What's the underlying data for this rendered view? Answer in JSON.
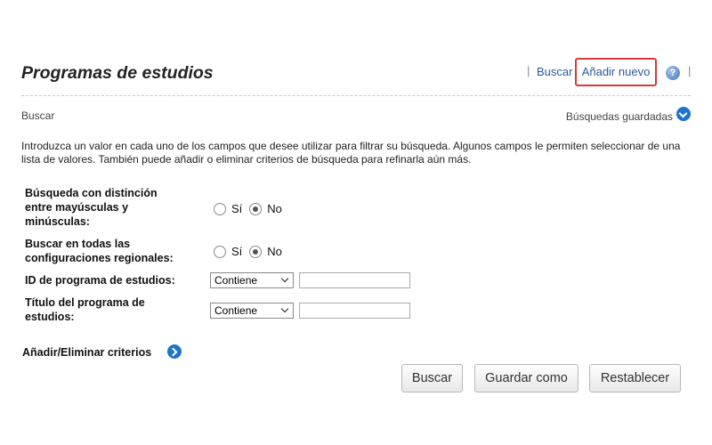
{
  "header": {
    "title": "Programas de estudios",
    "search_link": "Buscar",
    "add_new_link": "Añadir nuevo",
    "help_icon": "question-icon"
  },
  "subheader": {
    "search_label": "Buscar",
    "saved_searches": "Búsquedas guardadas"
  },
  "intro_text": "Introduzca un valor en cada uno de los campos que desee utilizar para filtrar su búsqueda. Algunos campos le permiten seleccionar de una lista de valores. También puede añadir o eliminar criterios de búsqueda para refinarla aún más.",
  "form": {
    "case_sensitive": {
      "label_line1": "Búsqueda con distinción",
      "label_line2": "entre mayúsculas y",
      "label_line3": "minúsculas:",
      "yes": "Sí",
      "no": "No",
      "selected": "No"
    },
    "all_locales": {
      "label_line1": "Buscar en todas las",
      "label_line2": "configuraciones regionales:",
      "yes": "Sí",
      "no": "No",
      "selected": "No"
    },
    "program_id": {
      "label": "ID de programa de estudios:",
      "operator": "Contiene",
      "value": ""
    },
    "program_title": {
      "label_line1": "Título del programa de",
      "label_line2": "estudios:",
      "operator": "Contiene",
      "value": ""
    }
  },
  "add_remove_criteria": "Añadir/Eliminar criterios",
  "buttons": {
    "search": "Buscar",
    "save_as": "Guardar como",
    "reset": "Restablecer"
  },
  "colors": {
    "link": "#2a5aa0",
    "highlight_border": "#d9383e",
    "icon_blue": "#1f73c8"
  }
}
